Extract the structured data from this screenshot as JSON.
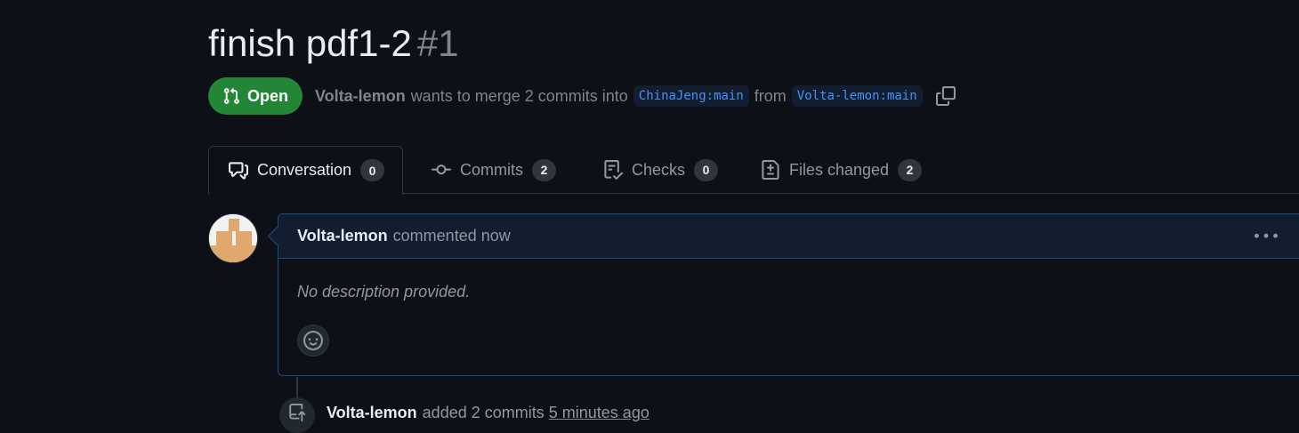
{
  "pr": {
    "title": "finish pdf1-2",
    "number": "#1",
    "state": "Open",
    "author": "Volta-lemon",
    "merge_text": "wants to merge 2 commits into",
    "base_branch": "ChinaJeng:main",
    "from_text": "from",
    "head_branch": "Volta-lemon:main"
  },
  "tabs": [
    {
      "label": "Conversation",
      "count": "0",
      "icon": "comment-discussion-icon",
      "active": true
    },
    {
      "label": "Commits",
      "count": "2",
      "icon": "git-commit-icon",
      "active": false
    },
    {
      "label": "Checks",
      "count": "0",
      "icon": "checklist-icon",
      "active": false
    },
    {
      "label": "Files changed",
      "count": "2",
      "icon": "file-diff-icon",
      "active": false
    }
  ],
  "comment": {
    "author": "Volta-lemon",
    "when": "commented now",
    "body": "No description provided."
  },
  "timeline": {
    "author": "Volta-lemon",
    "action": "added 2 commits",
    "time": "5 minutes ago"
  },
  "colors": {
    "background": "#0d1117",
    "open_badge": "#238636",
    "branch_link": "#4493f8",
    "comment_header": "#121d2f"
  }
}
